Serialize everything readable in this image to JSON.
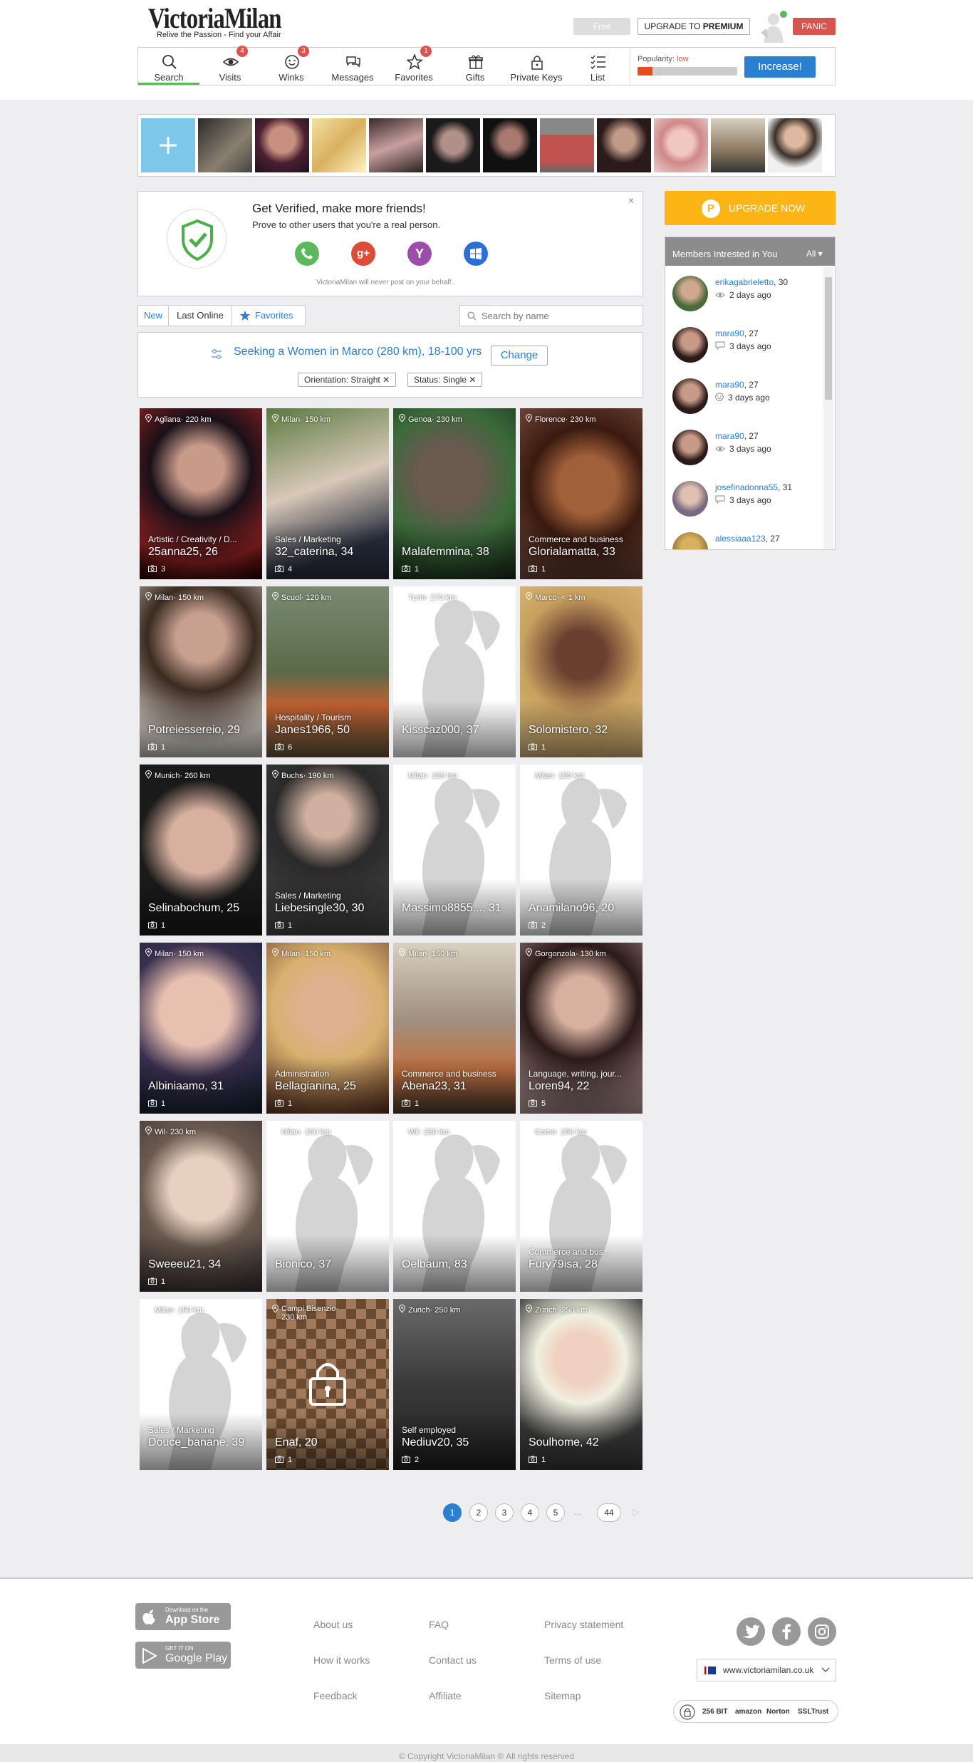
{
  "header": {
    "logo": "VictoriaMilan",
    "tagline": "Relive the Passion - Find your Affair",
    "free_label": "Free",
    "upgrade_prefix": "UPGRADE TO",
    "upgrade_bold": "PREMIUM",
    "panic_label": "PANIC"
  },
  "nav": {
    "items": [
      {
        "label": "Search",
        "badge": ""
      },
      {
        "label": "Visits",
        "badge": "4"
      },
      {
        "label": "Winks",
        "badge": "3"
      },
      {
        "label": "Messages",
        "badge": ""
      },
      {
        "label": "Favorites",
        "badge": "1"
      },
      {
        "label": "Gifts",
        "badge": ""
      },
      {
        "label": "Private Keys",
        "badge": ""
      },
      {
        "label": "List",
        "badge": ""
      }
    ],
    "popularity_label": "Popularity:",
    "popularity_value": "low",
    "popularity_level": 0.15,
    "increase_label": "Increase!"
  },
  "verify": {
    "title": "Get Verified, make more friends!",
    "subtitle": "Prove to other users that you're a real person.",
    "note": "VictoriaMilan will never post on your behalf.",
    "close": "×",
    "google_glyph": "g+",
    "yahoo_glyph": "Y"
  },
  "filters": {
    "tab_new": "New",
    "tab_last_online": "Last Online",
    "tab_favorites": "Favorites",
    "search_placeholder": "Search by name"
  },
  "seek": {
    "text": "Seeking a Women in Marco (280 km), 18-100 yrs",
    "change_label": "Change",
    "chip_orientation": "Orientation: Straight",
    "chip_status": "Status: Single",
    "chip_remove": "✕"
  },
  "profiles": [
    {
      "loc": "Agliana· 220 km",
      "industry": "Artistic / Creativity / D...",
      "name": "25anna25, 26",
      "photos": "3"
    },
    {
      "loc": "Milan· 150 km",
      "industry": "Sales / Marketing",
      "name": "32_caterina, 34",
      "photos": "4"
    },
    {
      "loc": "Genoa· 230 km",
      "industry": "",
      "name": "Malafemmina, 38",
      "photos": "1"
    },
    {
      "loc": "Florence· 230 km",
      "industry": "Commerce and business",
      "name": "Glorialamatta, 33",
      "photos": "1"
    },
    {
      "loc": "Milan· 150 km",
      "industry": "",
      "name": "Potreiessereio, 29",
      "photos": "1"
    },
    {
      "loc": "Scuol· 120 km",
      "industry": "Hospitality / Tourism",
      "name": "Janes1966, 50",
      "photos": "6"
    },
    {
      "loc": "Turin· 270 km",
      "industry": "",
      "name": "Kisscaz000, 37",
      "photos": ""
    },
    {
      "loc": "Marco· < 1 km",
      "industry": "",
      "name": "Solomistero, 32",
      "photos": "1"
    },
    {
      "loc": "Munich· 260 km",
      "industry": "",
      "name": "Selinabochum, 25",
      "photos": "1"
    },
    {
      "loc": "Buchs· 190 km",
      "industry": "Sales / Marketing",
      "name": "Liebesingle30, 30",
      "photos": "1"
    },
    {
      "loc": "Milan· 150 km",
      "industry": "",
      "name": "Massimo8855..., 31",
      "photos": ""
    },
    {
      "loc": "Milan· 150 km",
      "industry": "",
      "name": "Anamilano96, 20",
      "photos": "2"
    },
    {
      "loc": "Milan· 150 km",
      "industry": "",
      "name": "Albiniaamo, 31",
      "photos": "1"
    },
    {
      "loc": "Milan· 150 km",
      "industry": "Administration",
      "name": "Bellagianina, 25",
      "photos": "1"
    },
    {
      "loc": "Milan· 150 km",
      "industry": "Commerce and business",
      "name": "Abena23, 31",
      "photos": "1"
    },
    {
      "loc": "Gorgonzola· 130 km",
      "industry": "Language, writing, jour...",
      "name": "Loren94, 22",
      "photos": "5"
    },
    {
      "loc": "Wil· 230 km",
      "industry": "",
      "name": "Sweeeu21, 34",
      "photos": "1"
    },
    {
      "loc": "Milan· 150 km",
      "industry": "",
      "name": "Bionico, 37",
      "photos": ""
    },
    {
      "loc": "Wil· 230 km",
      "industry": "",
      "name": "Oelbaum, 83",
      "photos": ""
    },
    {
      "loc": "Como· 150 km",
      "industry": "Commerce and bus...",
      "name": "Fury79isa, 28",
      "photos": ""
    },
    {
      "loc": "Milan· 150 km",
      "industry": "Sales / Marketing",
      "name": "Douce_banane, 39",
      "photos": ""
    },
    {
      "loc": "Campi Bisenzio· 230 km",
      "industry": "",
      "name": "Enaf, 20",
      "photos": "1"
    },
    {
      "loc": "Zurich· 250 km",
      "industry": "Self employed",
      "name": "Nediuv20, 35",
      "photos": "2"
    },
    {
      "loc": "Zurich· 250 km",
      "industry": "",
      "name": "Soulhome, 42",
      "photos": "1"
    }
  ],
  "pager": {
    "pages": [
      "1",
      "2",
      "3",
      "4",
      "5"
    ],
    "ellipsis": "...",
    "last": "44",
    "next": "▷"
  },
  "sidebar": {
    "upgrade_now": "UPGRADE NOW",
    "members_title": "Members Intrested in You",
    "members_filter": "All ▾",
    "members": [
      {
        "user": "erikagabrieletto",
        "age": ", 30",
        "when": "2 days ago"
      },
      {
        "user": "mara90",
        "age": ", 27",
        "when": "3 days ago"
      },
      {
        "user": "mara90",
        "age": ", 27",
        "when": "3 days ago"
      },
      {
        "user": "mara90",
        "age": ", 27",
        "when": "3 days ago"
      },
      {
        "user": "josefinadonna55",
        "age": ", 31",
        "when": "3 days ago"
      },
      {
        "user": "alessiaaa123",
        "age": ", 27",
        "when": ""
      }
    ]
  },
  "footer": {
    "appstore_small": "Download on the",
    "appstore_big": "App Store",
    "gplay_small": "GET IT ON",
    "gplay_big": "Google Play",
    "col1": [
      "About us",
      "How it works",
      "Feedback"
    ],
    "col2": [
      "FAQ",
      "Contact us",
      "Affiliate"
    ],
    "col3": [
      "Privacy statement",
      "Terms of use",
      "Sitemap"
    ],
    "site": "www.victoriamilan.co.uk",
    "security": [
      "256 BIT",
      "amazon",
      "Norton",
      "SSLTrust"
    ],
    "copyright": "© Copyright VictoriaMilan ® All rights reserved"
  }
}
